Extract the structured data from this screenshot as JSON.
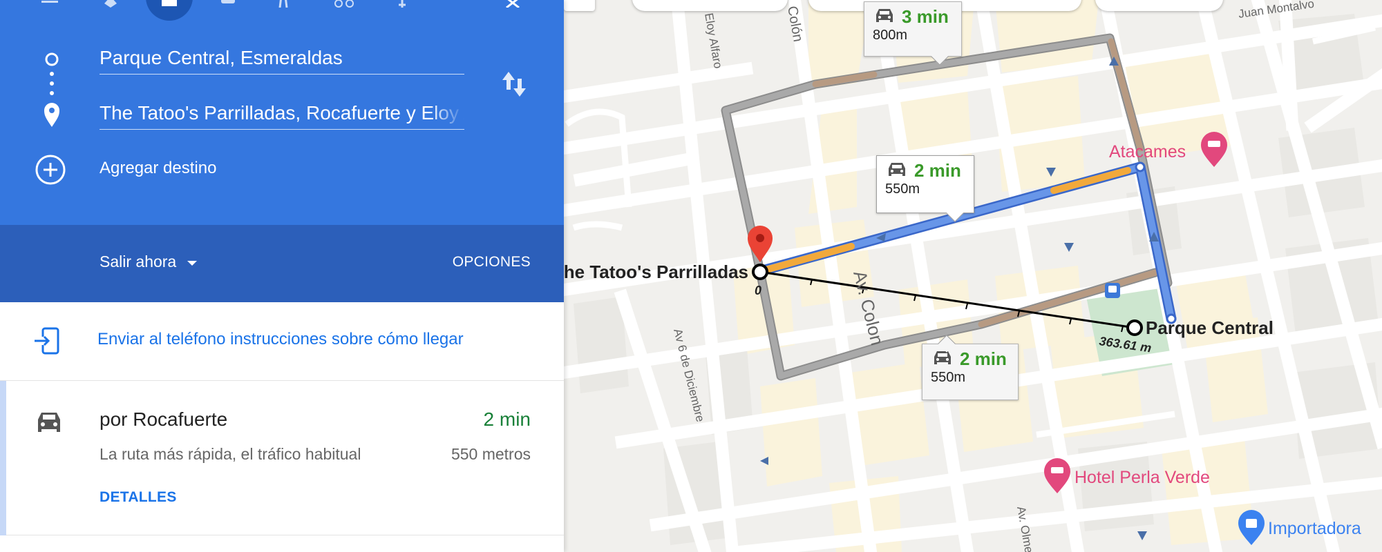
{
  "directions": {
    "origin": "Parque Central, Esmeraldas",
    "destination": "The Tatoo's Parrilladas, Rocafuerte y Eloy Alfaro",
    "add_destination": "Agregar destino"
  },
  "depart": {
    "label": "Salir ahora",
    "options_label": "OPCIONES"
  },
  "send": {
    "label": "Enviar al teléfono instrucciones sobre cómo llegar"
  },
  "route": {
    "title": "por Rocafuerte",
    "time": "2 min",
    "description": "La ruta más rápida, el tráfico habitual",
    "distance": "550 metros",
    "details_label": "DETALLES"
  },
  "map": {
    "bubbles": [
      {
        "time": "3 min",
        "distance": "800m"
      },
      {
        "time": "2 min",
        "distance": "550m"
      },
      {
        "time": "2 min",
        "distance": "550m"
      }
    ],
    "measure": {
      "start_label": "0",
      "end_label": "363.61 m"
    },
    "places": {
      "destination": "The Tatoo's Parrilladas",
      "origin": "Parque Central",
      "hotel_atacames": "Atacames",
      "hotel_perla": "Hotel Perla Verde",
      "shop": "Importadora"
    },
    "streets": {
      "colon_top": "Colón",
      "colon_mid": "Av. Colon",
      "eloy": "Eloy Alfaro",
      "diciembre": "Av 6 de Diciembre",
      "juan": "Juan Montalvo",
      "olmedo": "Av. Olmedo"
    },
    "colors": {
      "primary_route": "#6896e8",
      "alt_route": "#a5a5a5",
      "traffic_slow": "#f2a93b",
      "traffic_moderate": "#b79a82",
      "poi_hotel": "#e2487d",
      "poi_shop": "#3b82f0"
    }
  }
}
